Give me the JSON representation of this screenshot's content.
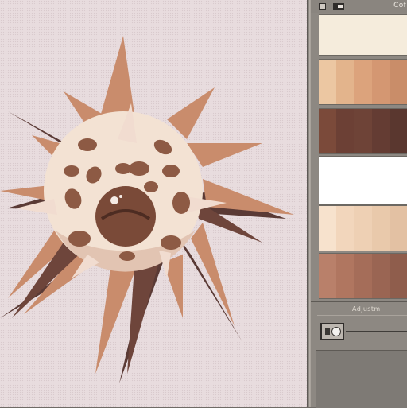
{
  "panel": {
    "title": "Cof",
    "section_label": "Adjustm",
    "toolbar_icons": [
      "panel-toggle-icon",
      "window-icon"
    ]
  },
  "swatches": {
    "row1": [
      "#f5ecdc"
    ],
    "row2": [
      "#ecc7a2",
      "#e3b48c",
      "#dca37c",
      "#d49772",
      "#c98d69"
    ],
    "row3": [
      "#7b4a3a",
      "#6c4035",
      "#6e4337",
      "#643c33",
      "#5a372f"
    ],
    "row4": [
      "#ffffff"
    ],
    "row5": [
      "#f7e2cd",
      "#f2d6bc",
      "#eed0b4",
      "#e9c9ab",
      "#e3c1a3"
    ],
    "row6": [
      "#b9806a",
      "#b07660",
      "#a56d59",
      "#9a6553",
      "#8f5d4c"
    ]
  },
  "colors": {
    "star_light": "#c98c6c",
    "star_dark": "#5a3a35",
    "ball": "#f3e2d3",
    "bean": "#8d5a44",
    "background": "#e8dcde"
  }
}
